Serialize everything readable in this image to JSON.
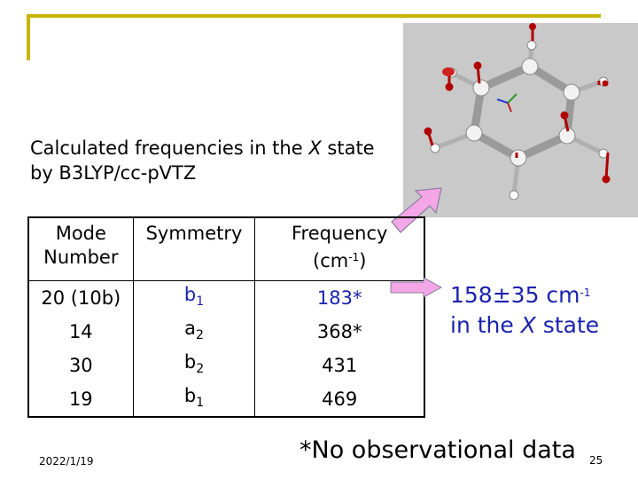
{
  "title_line1_prefix": "Calculated frequencies in the ",
  "title_state": "X",
  "title_line1_suffix": " state",
  "title_line2": "by B3LYP/cc-pVTZ",
  "table": {
    "headers": {
      "mode_line1": "Mode",
      "mode_line2": "Number",
      "symmetry": "Symmetry",
      "freq_line1": "Frequency",
      "freq_unit_base": "(cm",
      "freq_unit_exp": "-1",
      "freq_unit_close": ")"
    },
    "rows": [
      {
        "mode": "20 (10b)",
        "sym_base": "b",
        "sym_sub": "1",
        "freq": "183*"
      },
      {
        "mode": "14",
        "sym_base": "a",
        "sym_sub": "2",
        "freq": "368*"
      },
      {
        "mode": "30",
        "sym_base": "b",
        "sym_sub": "2",
        "freq": "431"
      },
      {
        "mode": "19",
        "sym_base": "b",
        "sym_sub": "1",
        "freq": "469"
      }
    ]
  },
  "result": {
    "value": "158±35 cm",
    "exp": "-1",
    "line2_prefix": "in the ",
    "line2_state": "X",
    "line2_suffix": " state"
  },
  "footer": {
    "date": "2022/1/19",
    "note": "*No observational data",
    "page": "25"
  },
  "colors": {
    "accent_blue": "#1a23b0",
    "frame_gold": "#c8b400",
    "arrow_pink": "#f4a6e6",
    "panel_gray": "#c9c9c9"
  }
}
